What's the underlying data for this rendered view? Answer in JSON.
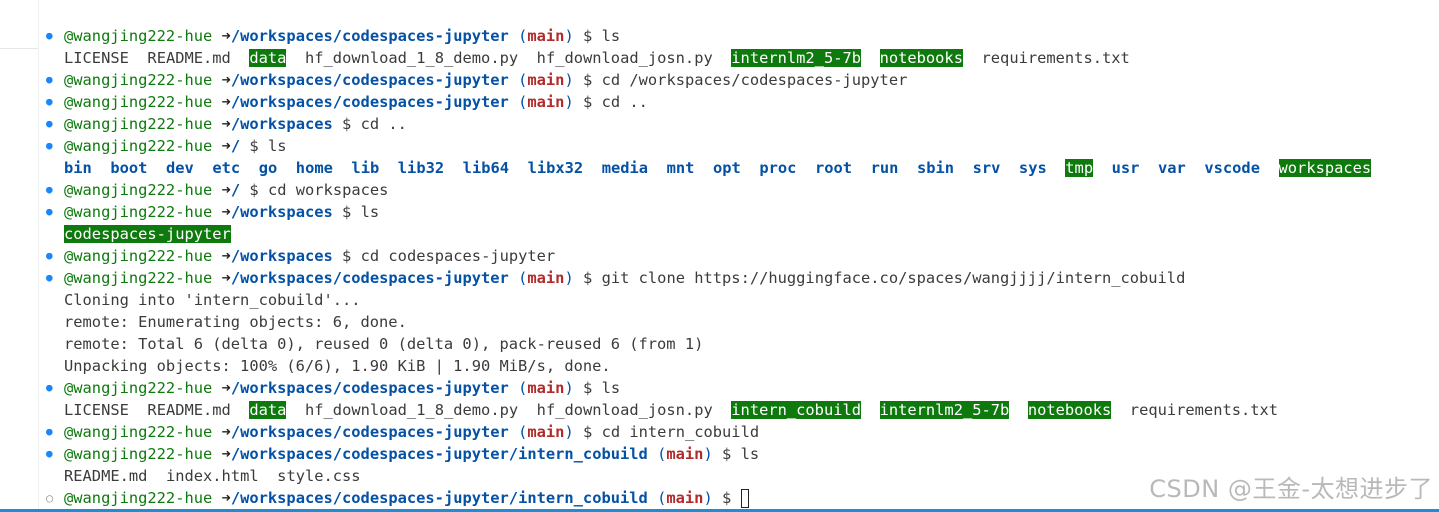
{
  "prompt": {
    "user": "@wangjing222-hue",
    "arrow": "➜",
    "dollar": "$"
  },
  "lines": [
    {
      "p": 1,
      "marker": "filled",
      "path": "/workspaces/codespaces-jupyter",
      "branch": "main",
      "cmd": "ls"
    },
    {
      "p": 0,
      "items": [
        {
          "t": "LICENSE",
          "s": "file"
        },
        {
          "t": "README.md",
          "s": "file"
        },
        {
          "t": "data",
          "s": "hl"
        },
        {
          "t": "hf_download_1_8_demo.py",
          "s": "file"
        },
        {
          "t": "hf_download_josn.py",
          "s": "file"
        },
        {
          "t": "internlm2_5-7b",
          "s": "hl"
        },
        {
          "t": "notebooks",
          "s": "hl"
        },
        {
          "t": "requirements.txt",
          "s": "file"
        }
      ]
    },
    {
      "p": 1,
      "marker": "filled",
      "path": "/workspaces/codespaces-jupyter",
      "branch": "main",
      "cmd": "cd /workspaces/codespaces-jupyter"
    },
    {
      "p": 1,
      "marker": "filled",
      "path": "/workspaces/codespaces-jupyter",
      "branch": "main",
      "cmd": "cd .."
    },
    {
      "p": 1,
      "marker": "filled",
      "path": "/workspaces",
      "branch": "",
      "cmd": "cd .."
    },
    {
      "p": 1,
      "marker": "filled",
      "path": "/",
      "branch": "",
      "cmd": "ls"
    },
    {
      "p": 0,
      "items": [
        {
          "t": "bin",
          "s": "dir"
        },
        {
          "t": "boot",
          "s": "dir"
        },
        {
          "t": "dev",
          "s": "dir"
        },
        {
          "t": "etc",
          "s": "dir"
        },
        {
          "t": "go",
          "s": "dir"
        },
        {
          "t": "home",
          "s": "dir"
        },
        {
          "t": "lib",
          "s": "dir"
        },
        {
          "t": "lib32",
          "s": "dir"
        },
        {
          "t": "lib64",
          "s": "dir"
        },
        {
          "t": "libx32",
          "s": "dir"
        },
        {
          "t": "media",
          "s": "dir"
        },
        {
          "t": "mnt",
          "s": "dir"
        },
        {
          "t": "opt",
          "s": "dir"
        },
        {
          "t": "proc",
          "s": "dir"
        },
        {
          "t": "root",
          "s": "dir"
        },
        {
          "t": "run",
          "s": "dir"
        },
        {
          "t": "sbin",
          "s": "dir"
        },
        {
          "t": "srv",
          "s": "dir"
        },
        {
          "t": "sys",
          "s": "dir"
        },
        {
          "t": "tmp",
          "s": "hl"
        },
        {
          "t": "usr",
          "s": "dir"
        },
        {
          "t": "var",
          "s": "dir"
        },
        {
          "t": "vscode",
          "s": "dir"
        },
        {
          "t": "workspaces",
          "s": "hl"
        }
      ]
    },
    {
      "p": 1,
      "marker": "filled",
      "path": "/",
      "branch": "",
      "cmd": "cd workspaces"
    },
    {
      "p": 1,
      "marker": "filled",
      "path": "/workspaces",
      "branch": "",
      "cmd": "ls"
    },
    {
      "p": 0,
      "items": [
        {
          "t": "codespaces-jupyter",
          "s": "hl"
        }
      ]
    },
    {
      "p": 1,
      "marker": "filled",
      "path": "/workspaces",
      "branch": "",
      "cmd": "cd codespaces-jupyter"
    },
    {
      "p": 1,
      "marker": "filled",
      "path": "/workspaces/codespaces-jupyter",
      "branch": "main",
      "cmd": "git clone https://huggingface.co/spaces/wangjjjj/intern_cobuild"
    },
    {
      "p": 0,
      "text": "Cloning into 'intern_cobuild'..."
    },
    {
      "p": 0,
      "text": "remote: Enumerating objects: 6, done."
    },
    {
      "p": 0,
      "text": "remote: Total 6 (delta 0), reused 0 (delta 0), pack-reused 6 (from 1)"
    },
    {
      "p": 0,
      "text": "Unpacking objects: 100% (6/6), 1.90 KiB | 1.90 MiB/s, done."
    },
    {
      "p": 1,
      "marker": "filled",
      "path": "/workspaces/codespaces-jupyter",
      "branch": "main",
      "cmd": "ls"
    },
    {
      "p": 0,
      "items": [
        {
          "t": "LICENSE",
          "s": "file"
        },
        {
          "t": "README.md",
          "s": "file"
        },
        {
          "t": "data",
          "s": "hl"
        },
        {
          "t": "hf_download_1_8_demo.py",
          "s": "file"
        },
        {
          "t": "hf_download_josn.py",
          "s": "file"
        },
        {
          "t": "intern_cobuild",
          "s": "hl"
        },
        {
          "t": "internlm2_5-7b",
          "s": "hl"
        },
        {
          "t": "notebooks",
          "s": "hl"
        },
        {
          "t": "requirements.txt",
          "s": "file"
        }
      ]
    },
    {
      "p": 1,
      "marker": "filled",
      "path": "/workspaces/codespaces-jupyter",
      "branch": "main",
      "cmd": "cd intern_cobuild"
    },
    {
      "p": 1,
      "marker": "filled",
      "path": "/workspaces/codespaces-jupyter/intern_cobuild",
      "branch": "main",
      "cmd": "ls"
    },
    {
      "p": 0,
      "items": [
        {
          "t": "README.md",
          "s": "file"
        },
        {
          "t": "index.html",
          "s": "file"
        },
        {
          "t": "style.css",
          "s": "file"
        }
      ]
    },
    {
      "p": 1,
      "marker": "hollow",
      "path": "/workspaces/codespaces-jupyter/intern_cobuild",
      "branch": "main",
      "cmd": "",
      "cursor": true
    }
  ],
  "watermark": "CSDN @王金-太想进步了",
  "colors": {
    "user": "#0e7a0d",
    "path": "#0451a5",
    "branch": "#b22b2b",
    "highlight_bg": "#0e7a0d",
    "marker": "#1a85ff",
    "accent_bottom": "#1f8dd6"
  }
}
